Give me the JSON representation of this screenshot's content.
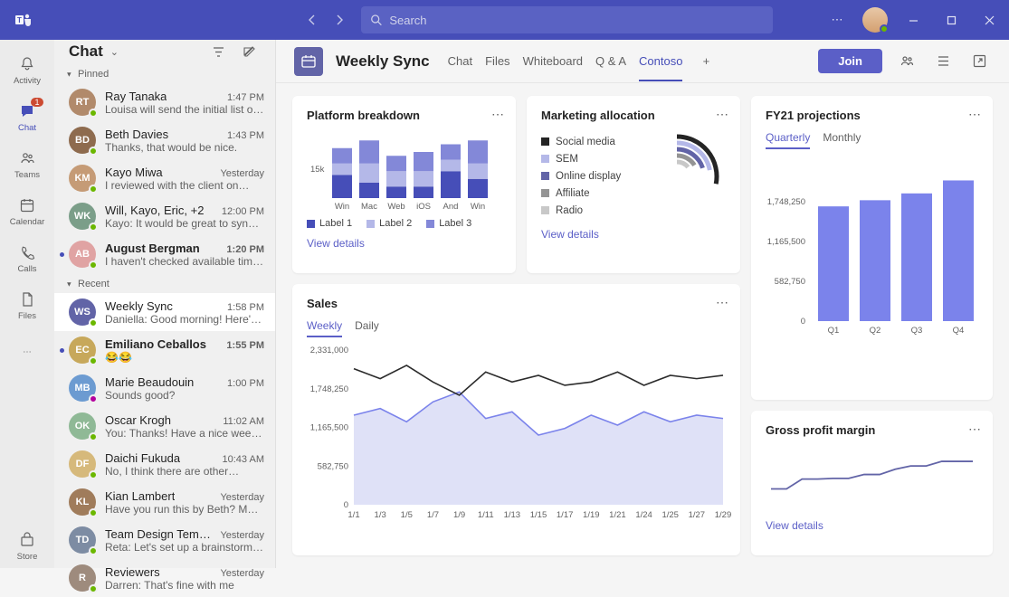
{
  "search": {
    "placeholder": "Search"
  },
  "rail": {
    "activity": "Activity",
    "chat": "Chat",
    "chat_badge": "1",
    "teams": "Teams",
    "calendar": "Calendar",
    "calls": "Calls",
    "files": "Files",
    "store": "Store"
  },
  "chatPanel": {
    "title": "Chat",
    "sectionPinned": "Pinned",
    "sectionRecent": "Recent",
    "items": [
      {
        "name": "Ray Tanaka",
        "preview": "Louisa will send the initial list of…",
        "time": "1:47 PM"
      },
      {
        "name": "Beth Davies",
        "preview": "Thanks, that would be nice.",
        "time": "1:43 PM"
      },
      {
        "name": "Kayo Miwa",
        "preview": "I reviewed with the client on…",
        "time": "Yesterday"
      },
      {
        "name": "Will, Kayo, Eric, +2",
        "preview": "Kayo: It would be great to sync…",
        "time": "12:00 PM"
      },
      {
        "name": "August Bergman",
        "preview": "I haven't checked available times…",
        "time": "1:20 PM"
      },
      {
        "name": "Weekly Sync",
        "preview": "Daniella: Good morning! Here's t…",
        "time": "1:58 PM"
      },
      {
        "name": "Emiliano Ceballos",
        "preview": "😂😂",
        "time": "1:55 PM"
      },
      {
        "name": "Marie Beaudouin",
        "preview": "Sounds good?",
        "time": "1:00 PM"
      },
      {
        "name": "Oscar Krogh",
        "preview": "You: Thanks! Have a nice weekend",
        "time": "11:02 AM"
      },
      {
        "name": "Daichi Fukuda",
        "preview": "No, I think there are other…",
        "time": "10:43 AM"
      },
      {
        "name": "Kian Lambert",
        "preview": "Have you run this by Beth? Make…",
        "time": "Yesterday"
      },
      {
        "name": "Team Design Template",
        "preview": "Reta: Let's set up a brainstorm…",
        "time": "Yesterday"
      },
      {
        "name": "Reviewers",
        "preview": "Darren: That's fine with me",
        "time": "Yesterday"
      }
    ]
  },
  "header": {
    "title": "Weekly Sync",
    "tabs": [
      "Chat",
      "Files",
      "Whiteboard",
      "Q & A",
      "Contoso"
    ],
    "activeTab": "Contoso",
    "join": "Join"
  },
  "cards": {
    "platform": {
      "title": "Platform breakdown",
      "link": "View details"
    },
    "marketing": {
      "title": "Marketing allocation",
      "link": "View details"
    },
    "projections": {
      "title": "FY21 projections",
      "tabQuarterly": "Quarterly",
      "tabMonthly": "Monthly"
    },
    "sales": {
      "title": "Sales",
      "tabWeekly": "Weekly",
      "tabDaily": "Daily"
    },
    "gross": {
      "title": "Gross profit margin",
      "link": "View details"
    }
  },
  "chart_data": [
    {
      "id": "platform",
      "type": "bar",
      "stacked": true,
      "ylabel": "15k",
      "categories": [
        "Win",
        "Mac",
        "Web",
        "iOS",
        "And",
        "Win"
      ],
      "series": [
        {
          "name": "Label 1",
          "values": [
            6,
            4,
            3,
            3,
            7,
            5
          ]
        },
        {
          "name": "Label 2",
          "values": [
            3,
            5,
            4,
            4,
            3,
            4
          ]
        },
        {
          "name": "Label 3",
          "values": [
            4,
            6,
            4,
            5,
            4,
            6
          ]
        }
      ]
    },
    {
      "id": "marketing",
      "type": "pie",
      "series": [
        {
          "name": "Social media",
          "value": 28
        },
        {
          "name": "SEM",
          "value": 22
        },
        {
          "name": "Online display",
          "value": 20
        },
        {
          "name": "Affiliate",
          "value": 16
        },
        {
          "name": "Radio",
          "value": 14
        }
      ]
    },
    {
      "id": "projections",
      "type": "bar",
      "categories": [
        "Q1",
        "Q2",
        "Q3",
        "Q4"
      ],
      "values": [
        1680000,
        1770000,
        1870000,
        2060000
      ],
      "y_ticks": [
        0,
        582750,
        1165500,
        1748250
      ],
      "ylim": [
        0,
        2331000
      ]
    },
    {
      "id": "sales",
      "type": "line",
      "x": [
        "1/1",
        "1/3",
        "1/5",
        "1/7",
        "1/9",
        "1/11",
        "1/13",
        "1/15",
        "1/17",
        "1/19",
        "1/21",
        "1/24",
        "1/25",
        "1/27",
        "1/29"
      ],
      "y_ticks": [
        0,
        582750,
        1165500,
        1748250,
        2331000
      ],
      "series": [
        {
          "name": "series-a",
          "values": [
            2050000,
            1900000,
            2100000,
            1850000,
            1650000,
            2000000,
            1850000,
            1950000,
            1800000,
            1850000,
            2000000,
            1800000,
            1950000,
            1900000,
            1950000
          ]
        },
        {
          "name": "series-b",
          "values": [
            1350000,
            1450000,
            1250000,
            1550000,
            1700000,
            1300000,
            1400000,
            1050000,
            1150000,
            1350000,
            1200000,
            1400000,
            1250000,
            1350000,
            1300000
          ]
        }
      ]
    },
    {
      "id": "gross",
      "type": "line",
      "x": [
        0,
        1,
        2,
        3,
        4,
        5,
        6,
        7,
        8,
        9,
        10,
        11,
        12,
        13
      ],
      "values": [
        20,
        20,
        35,
        35,
        36,
        36,
        42,
        42,
        50,
        55,
        55,
        62,
        62,
        62
      ]
    }
  ]
}
